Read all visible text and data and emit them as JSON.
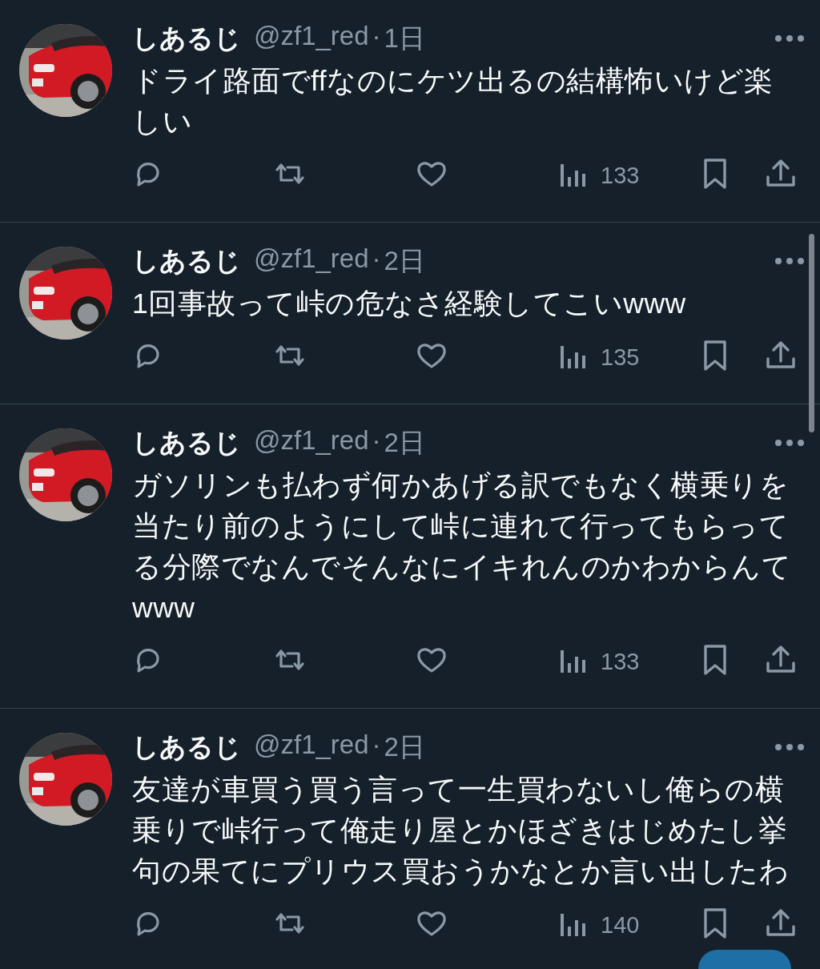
{
  "tweets": [
    {
      "name": "しあるじ",
      "handle": "@zf1_red",
      "separator": "·",
      "time": "1日",
      "text": "ドライ路面でffなのにケツ出るの結構怖いけど楽しい",
      "views": "133"
    },
    {
      "name": "しあるじ",
      "handle": "@zf1_red",
      "separator": "·",
      "time": "2日",
      "text": "1回事故って峠の危なさ経験してこいwww",
      "views": "135"
    },
    {
      "name": "しあるじ",
      "handle": "@zf1_red",
      "separator": "·",
      "time": "2日",
      "text": "ガソリンも払わず何かあげる訳でもなく横乗りを当たり前のようにして峠に連れて行ってもらってる分際でなんでそんなにイキれんのかわからんてwww",
      "views": "133"
    },
    {
      "name": "しあるじ",
      "handle": "@zf1_red",
      "separator": "·",
      "time": "2日",
      "text": "友達が車買う買う言って一生買わないし俺らの横乗りで峠行って俺走り屋とかほざきはじめたし挙句の果てにプリウス買おうかなとか言い出したわ",
      "views": "140"
    }
  ]
}
